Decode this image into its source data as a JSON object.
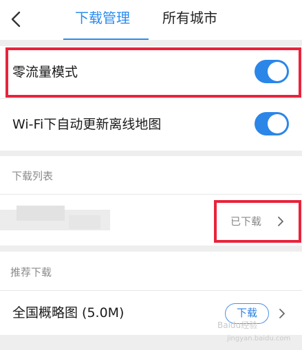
{
  "header": {
    "back_icon": "chevron-left-icon",
    "tabs": [
      {
        "label": "下载管理",
        "active": true
      },
      {
        "label": "所有城市",
        "active": false
      }
    ]
  },
  "settings": {
    "zero_traffic": {
      "label": "零流量模式",
      "enabled": true
    },
    "wifi_auto_update": {
      "label": "Wi-Fi下自动更新离线地图",
      "enabled": true
    }
  },
  "download_list": {
    "title": "下载列表",
    "item": {
      "status": "已下载",
      "chevron_icon": "chevron-right-icon"
    }
  },
  "recommended": {
    "title": "推荐下载",
    "item": {
      "label": "全国概略图 (5.0M)",
      "button_label": "下载",
      "chevron_icon": "chevron-right-icon"
    }
  },
  "watermark": {
    "text": "Baidu经验",
    "url": "jingyan.baidu.com"
  },
  "colors": {
    "accent": "#2b8cef",
    "toggle_on": "#2b86e8",
    "highlight": "#e8233b"
  }
}
